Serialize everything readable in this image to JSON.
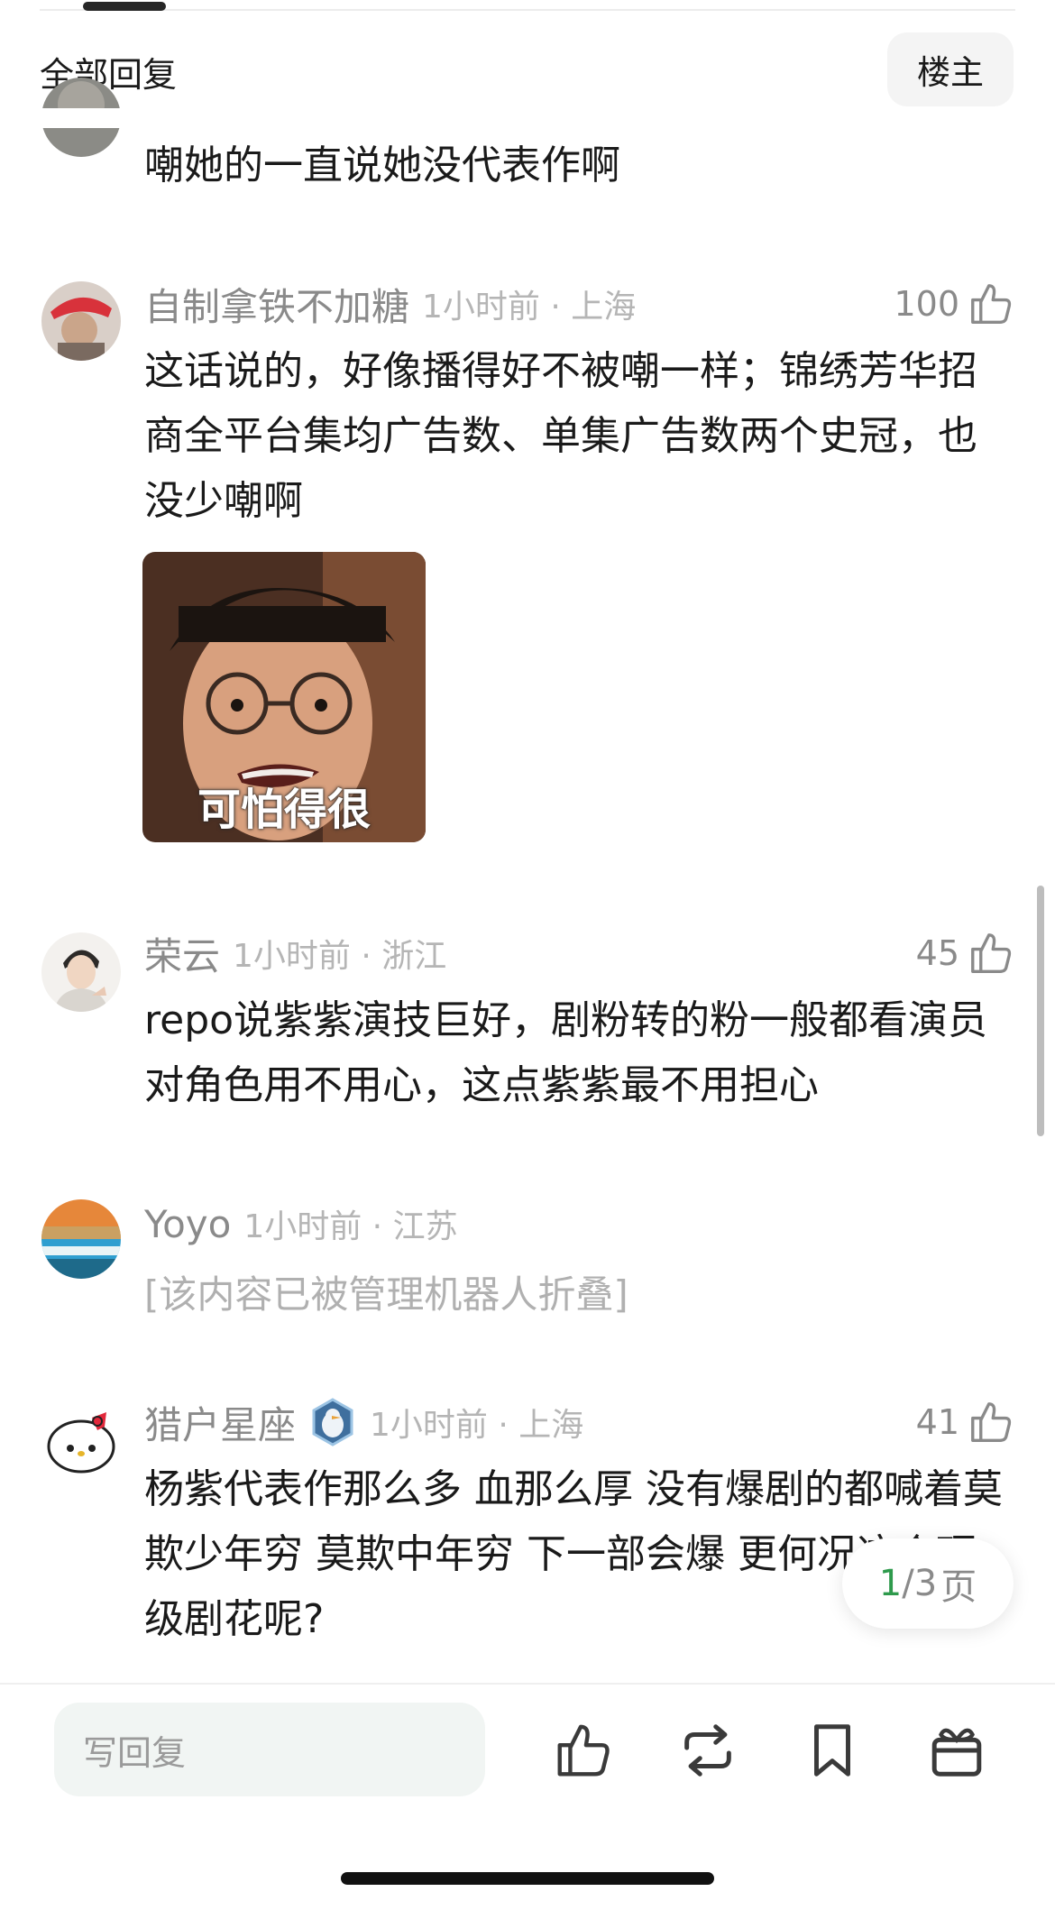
{
  "header": {
    "title": "全部回复",
    "op_button": "楼主"
  },
  "comments": [
    {
      "username": "",
      "body": "嘲她的一直说她没代表作啊"
    },
    {
      "username": "自制拿铁不加糖",
      "time_location": "1小时前 · 上海",
      "likes": "100",
      "body": "这话说的，好像播得好不被嘲一样；锦绣芳华招商全平台集均广告数、单集广告数两个史冠，也没少嘲啊",
      "image_caption": "可怕得很"
    },
    {
      "username": "荣云",
      "time_location": "1小时前 · 浙江",
      "likes": "45",
      "body": "repo说紫紫演技巨好，剧粉转的粉一般都看演员对角色用不用心，这点紫紫最不用担心"
    },
    {
      "username": "Yoyo",
      "time_location": "1小时前 · 江苏",
      "folded_text": "[该内容已被管理机器人折叠]"
    },
    {
      "username": "猎户星座",
      "time_location": "1小时前 · 上海",
      "likes": "41",
      "body": "杨紫代表作那么多 血那么厚 没有爆剧的都喊着莫欺少年穷 莫欺中年穷 下一部会爆 更何况这个顶级剧花呢?"
    }
  ],
  "pager": {
    "current": "1",
    "separator": "/",
    "total": "3",
    "unit": "页"
  },
  "bottom_bar": {
    "reply_placeholder": "写回复",
    "icons": [
      "like-icon",
      "repost-icon",
      "bookmark-icon",
      "gift-icon"
    ]
  },
  "colors": {
    "accent_green": "#2e9a4c",
    "meta_gray": "#8a8a8a",
    "input_bg": "#f1f5f3"
  }
}
